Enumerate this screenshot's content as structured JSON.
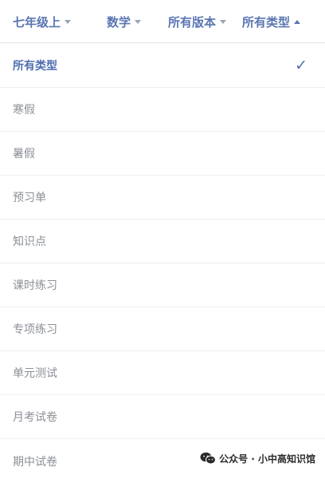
{
  "filters": [
    {
      "label": "七年级上",
      "state": "collapsed"
    },
    {
      "label": "数学",
      "state": "collapsed"
    },
    {
      "label": "所有版本",
      "state": "collapsed"
    },
    {
      "label": "所有类型",
      "state": "expanded"
    }
  ],
  "dropdown": {
    "selected_index": 0,
    "check_icon": "check-icon",
    "options": [
      {
        "label": "所有类型"
      },
      {
        "label": "寒假"
      },
      {
        "label": "暑假"
      },
      {
        "label": "预习单"
      },
      {
        "label": "知识点"
      },
      {
        "label": "课时练习"
      },
      {
        "label": "专项练习"
      },
      {
        "label": "单元测试"
      },
      {
        "label": "月考试卷"
      },
      {
        "label": "期中试卷"
      }
    ]
  },
  "watermark": {
    "text": "公众号 · 小中高知识馆",
    "icon": "wechat-icon"
  },
  "colors": {
    "accent": "#4f6fb0",
    "filter_text": "#5a76b2",
    "option_text": "#8b8f96"
  }
}
